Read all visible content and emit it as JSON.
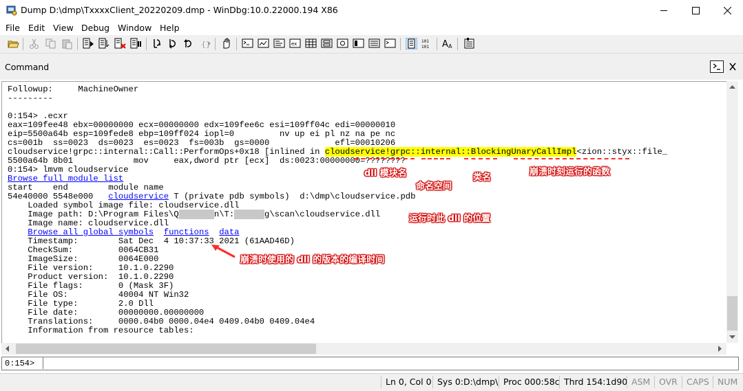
{
  "window": {
    "title": "Dump D:\\dmp\\TxxxxClient_20220209.dmp - WinDbg:10.0.22000.194 X86"
  },
  "menu": [
    "File",
    "Edit",
    "View",
    "Debug",
    "Window",
    "Help"
  ],
  "toolbar": {
    "icons": [
      "open-folder",
      "cut",
      "copy",
      "paste",
      "go",
      "restart",
      "stop",
      "break",
      "step-into",
      "step-over",
      "step-out",
      "run-to-cursor",
      "source-mode",
      "command",
      "watch",
      "locals",
      "registers",
      "memory",
      "call-stack",
      "disassembly",
      "scratch-pad",
      "processes",
      "source-mode-toggle",
      "hex-mode",
      "font",
      "options"
    ]
  },
  "pane": {
    "title": "Command"
  },
  "output": {
    "lines": [
      "Followup:     MachineOwner",
      "---------",
      "",
      "0:154> .ecxr",
      "eax=109fee48 ebx=00000000 ecx=00000000 edx=109fee6c esi=109ff04c edi=00000010",
      "eip=5500a64b esp=109fede8 ebp=109ff024 iopl=0         nv up ei pl nz na pe nc",
      "cs=001b  ss=0023  ds=0023  es=0023  fs=003b  gs=0000             efl=00010206"
    ],
    "line_callsite_prefix": "cloudservice!grpc::internal::Call::PerformOps+0x18 [inlined in ",
    "line_callsite_highlight": "cloudservice!grpc::internal::BlockingUnaryCallImpl",
    "line_callsite_suffix": "<zion::styx::file_",
    "line_instruction": "5500a64b 8b01            mov     eax,dword ptr [ecx]  ds:0023:00000000=????????",
    "line_lmvm": "0:154> lmvm cloudservice",
    "browse_full": "Browse full module list",
    "header_row": "start    end        module name",
    "module_row_prefix": "54e40000 5548e000   ",
    "module_link": "cloudservice",
    "module_row_suffix": " T (private pdb symbols)  d:\\dmp\\cloudservice.pdb",
    "loaded_symbol": "    Loaded symbol image file: cloudservice.dll",
    "image_path": "    Image path: D:\\Program Files\\Q",
    "image_path_blur1": "       ",
    "image_path_mid": "n\\T:",
    "image_path_blur2": "      ",
    "image_path_end": "g\\scan\\cloudservice.dll",
    "image_name": "    Image name: cloudservice.dll",
    "browse_symbols": "Browse all global symbols",
    "functions_link": "functions",
    "data_link": "data",
    "timestamp_label": "    Timestamp:        Sat Dec  4 10:37:33 2021",
    "timestamp_hex": " (61AAD46D)",
    "details": [
      "    CheckSum:         0064CB31",
      "    ImageSize:        0064E000",
      "    File version:     10.1.0.2290",
      "    Product version:  10.1.0.2290",
      "    File flags:       0 (Mask 3F)",
      "    File OS:          40004 NT Win32",
      "    File type:        2.0 Dll",
      "    File date:        00000000.00000000",
      "    Translations:     0000.04b0 0000.04e4 0409.04b0 0409.04e4",
      "    Information from resource tables:"
    ]
  },
  "annotations": {
    "dll_module": "dll 模块名",
    "namespace": "命名空间",
    "class_name": "类名",
    "crash_func": "崩溃时刻运行的函数",
    "dll_location": "运行时此 dll 的位置",
    "compile_time": "崩溃时使用的 dll 的版本的编译时间"
  },
  "prompt": {
    "label": "0:154>",
    "value": ""
  },
  "status": {
    "position": "Ln 0, Col 0",
    "sys": "Sys 0:D:\\dmp\\",
    "proc": "Proc 000:58c",
    "thrd": "Thrd 154:1d90",
    "asm": "ASM",
    "ovr": "OVR",
    "caps": "CAPS",
    "num": "NUM"
  },
  "colors": {
    "highlight": "#ffff00",
    "link": "#0000ff",
    "annotation_red": "#e00000"
  }
}
